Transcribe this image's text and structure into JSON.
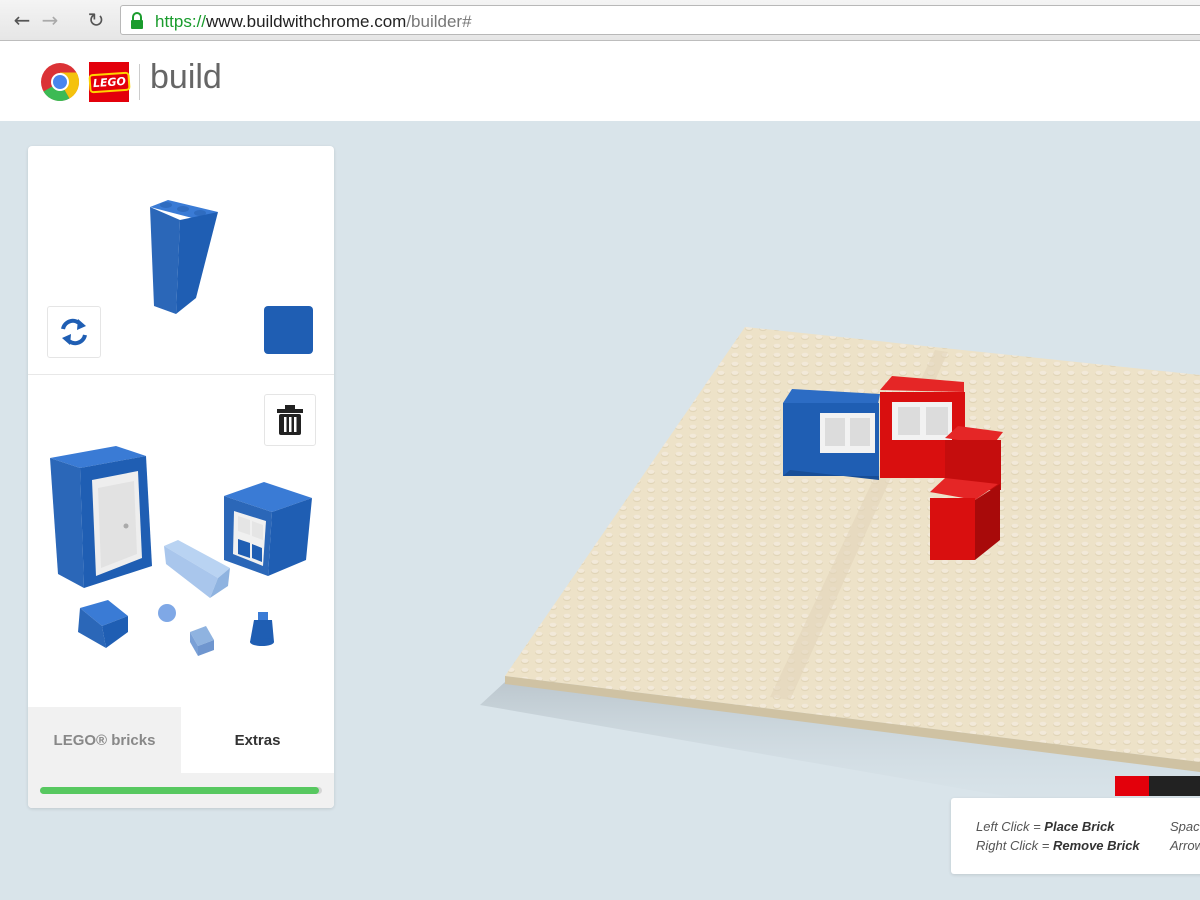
{
  "browser": {
    "url": {
      "scheme": "https://",
      "host": "www.buildwithchrome.com",
      "path": "/builder#"
    },
    "icons": {
      "back": "arrow-left-icon",
      "forward": "arrow-right-icon",
      "reload": "reload-icon",
      "lock": "lock-icon"
    }
  },
  "header": {
    "title": "build",
    "lego_logo_text": "LEGO"
  },
  "panel": {
    "selected_brick_color": "#1f5eb3",
    "tabs": [
      {
        "label": "LEGO® bricks",
        "active": false
      },
      {
        "label": "Extras",
        "active": true
      }
    ],
    "progress": 0.99
  },
  "help": {
    "left_click": "Left Click",
    "place": "Place Brick",
    "right_click": "Right Click",
    "remove": "Remove Brick",
    "col2_row1": "Spac",
    "col2_row2": "Arrow",
    "equals": " = "
  },
  "colors": {
    "accent_blue": "#1f5eb3",
    "brick_red": "#d90f0f",
    "baseplate": "#ede2c8",
    "background": "#d9e4ea",
    "progress_green": "#57c860"
  }
}
